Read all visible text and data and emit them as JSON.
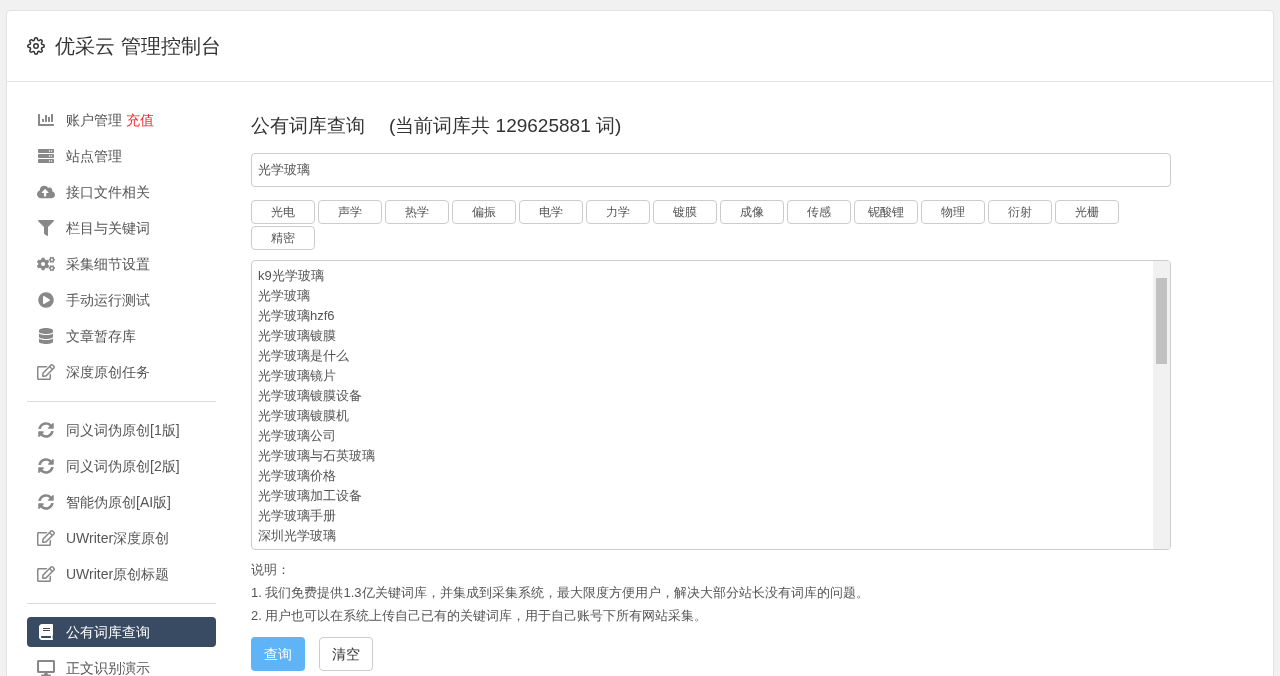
{
  "header": {
    "title": "优采云 管理控制台"
  },
  "sidebar": {
    "groups": [
      [
        {
          "label": "账户管理",
          "badge": "充值",
          "kind": "chart",
          "selected": false
        },
        {
          "label": "站点管理",
          "kind": "server",
          "selected": false
        },
        {
          "label": "接口文件相关",
          "kind": "cloud",
          "selected": false
        },
        {
          "label": "栏目与关键词",
          "kind": "filter",
          "selected": false
        },
        {
          "label": "采集细节设置",
          "kind": "gears",
          "selected": false
        },
        {
          "label": "手动运行测试",
          "kind": "play",
          "selected": false
        },
        {
          "label": "文章暂存库",
          "kind": "database",
          "selected": false
        },
        {
          "label": "深度原创任务",
          "kind": "edit",
          "selected": false
        }
      ],
      [
        {
          "label": "同义词伪原创[1版]",
          "kind": "refresh",
          "selected": false
        },
        {
          "label": "同义词伪原创[2版]",
          "kind": "refresh",
          "selected": false
        },
        {
          "label": "智能伪原创[AI版]",
          "kind": "refresh",
          "selected": false
        },
        {
          "label": "UWriter深度原创",
          "kind": "edit",
          "selected": false
        },
        {
          "label": "UWriter原创标题",
          "kind": "edit",
          "selected": false
        }
      ],
      [
        {
          "label": "公有词库查询",
          "kind": "book",
          "selected": true
        },
        {
          "label": "正文识别演示",
          "kind": "monitor",
          "selected": false
        }
      ]
    ]
  },
  "main": {
    "title": "公有词库查询",
    "subtitle": "(当前词库共 129625881 词)",
    "search": {
      "value": "光学玻璃"
    },
    "tags": [
      "光电",
      "声学",
      "热学",
      "偏振",
      "电学",
      "力学",
      "镀膜",
      "成像",
      "传感",
      "铌酸锂",
      "物理",
      "衍射",
      "光栅",
      "精密"
    ],
    "results": [
      "k9光学玻璃",
      "光学玻璃",
      "光学玻璃hzf6",
      "光学玻璃镀膜",
      "光学玻璃是什么",
      "光学玻璃镜片",
      "光学玻璃镀膜设备",
      "光学玻璃镀膜机",
      "光学玻璃公司",
      "光学玻璃与石英玻璃",
      "光学玻璃价格",
      "光学玻璃加工设备",
      "光学玻璃手册",
      "深圳光学玻璃"
    ],
    "notes": {
      "title": "说明：",
      "lines": [
        "1. 我们免费提供1.3亿关键词库，并集成到采集系统，最大限度方便用户，解决大部分站长没有词库的问题。",
        "2. 用户也可以在系统上传自己已有的关键词库，用于自己账号下所有网站采集。"
      ]
    },
    "buttons": [
      {
        "label": "查询",
        "kind": "primary"
      },
      {
        "label": "清空",
        "kind": "default"
      }
    ]
  }
}
